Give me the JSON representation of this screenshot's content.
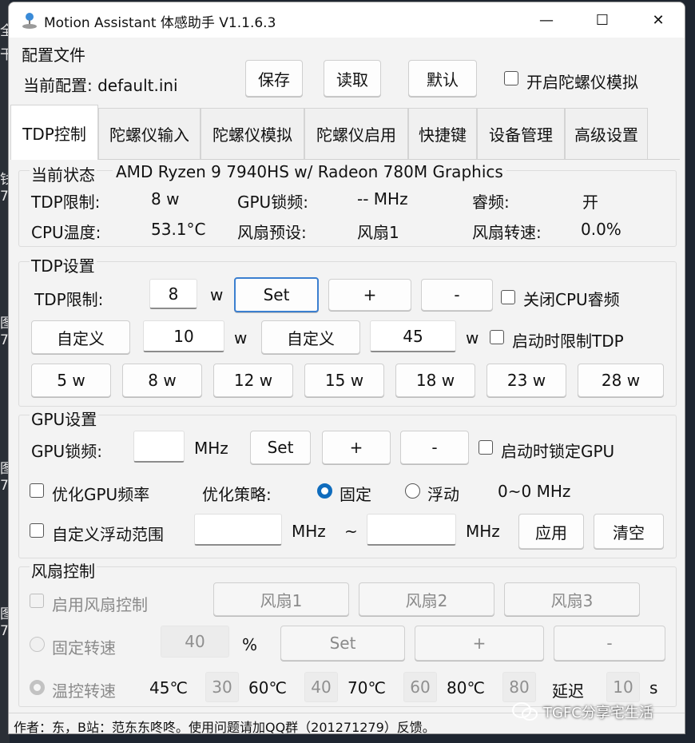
{
  "desktop": {
    "glyphs": [
      "全",
      "干",
      "钱",
      "7",
      "图",
      "7",
      "图",
      "7",
      "图",
      "7"
    ]
  },
  "window": {
    "title": "Motion Assistant 体感助手 V1.1.6.3",
    "controls": {
      "minimize": "—",
      "maximize": "☐",
      "close": "✕"
    }
  },
  "config": {
    "section_title": "配置文件",
    "current_label": "当前配置: default.ini",
    "save": "保存",
    "load": "读取",
    "default": "默认",
    "gyro_sim_enable": "开启陀螺仪模拟"
  },
  "tabs": [
    "TDP控制",
    "陀螺仪输入",
    "陀螺仪模拟",
    "陀螺仪启用",
    "快捷键",
    "设备管理",
    "高级设置"
  ],
  "status": {
    "title": "当前状态",
    "cpu_name": "AMD Ryzen 9 7940HS w/ Radeon 780M Graphics",
    "tdp_limit_label": "TDP限制:",
    "tdp_limit_value": "8 w",
    "gpu_lock_label": "GPU锁频:",
    "gpu_lock_value": "-- MHz",
    "boost_label": "睿频:",
    "boost_value": "开",
    "cpu_temp_label": "CPU温度:",
    "cpu_temp_value": "53.1°C",
    "fan_preset_label": "风扇预设:",
    "fan_preset_value": "风扇1",
    "fan_speed_label": "风扇转速:",
    "fan_speed_value": "0.0%"
  },
  "tdp": {
    "title": "TDP设置",
    "limit_label": "TDP限制:",
    "limit_value": "8",
    "unit": "w",
    "set": "Set",
    "plus": "+",
    "minus": "-",
    "disable_boost": "关闭CPU睿频",
    "custom1_label": "自定义",
    "custom1_value": "10",
    "custom2_label": "自定义",
    "custom2_value": "45",
    "limit_on_start": "启动时限制TDP",
    "presets": [
      "5 w",
      "8 w",
      "12 w",
      "15 w",
      "18 w",
      "23 w",
      "28 w"
    ]
  },
  "gpu": {
    "title": "GPU设置",
    "lock_label": "GPU锁频:",
    "lock_value": "",
    "unit": "MHz",
    "set": "Set",
    "plus": "+",
    "minus": "-",
    "lock_on_start": "启动时锁定GPU",
    "optimize": "优化GPU频率",
    "strategy_label": "优化策略:",
    "strategy_fixed": "固定",
    "strategy_float": "浮动",
    "range_text": "0~0 MHz",
    "custom_range": "自定义浮动范围",
    "range_min": "",
    "range_max": "",
    "range_sep": "~",
    "apply": "应用",
    "clear": "清空"
  },
  "fan": {
    "title": "风扇控制",
    "enable": "启用风扇控制",
    "fan_buttons": [
      "风扇1",
      "风扇2",
      "风扇3"
    ],
    "fixed_label": "固定转速",
    "fixed_value": "40",
    "percent": "%",
    "set": "Set",
    "plus": "+",
    "minus": "-",
    "temp_label": "温控转速",
    "temps": [
      "45℃",
      "60℃",
      "70℃",
      "80℃"
    ],
    "speeds": [
      "30",
      "40",
      "60",
      "80"
    ],
    "delay_label": "延迟",
    "delay_value": "10",
    "delay_unit": "s"
  },
  "footer": {
    "text": "作者：东，B站：范东东咚咚。使用问题请加QQ群（201271279）反馈。"
  },
  "watermark": {
    "text": "TGFC分享宅生活"
  }
}
